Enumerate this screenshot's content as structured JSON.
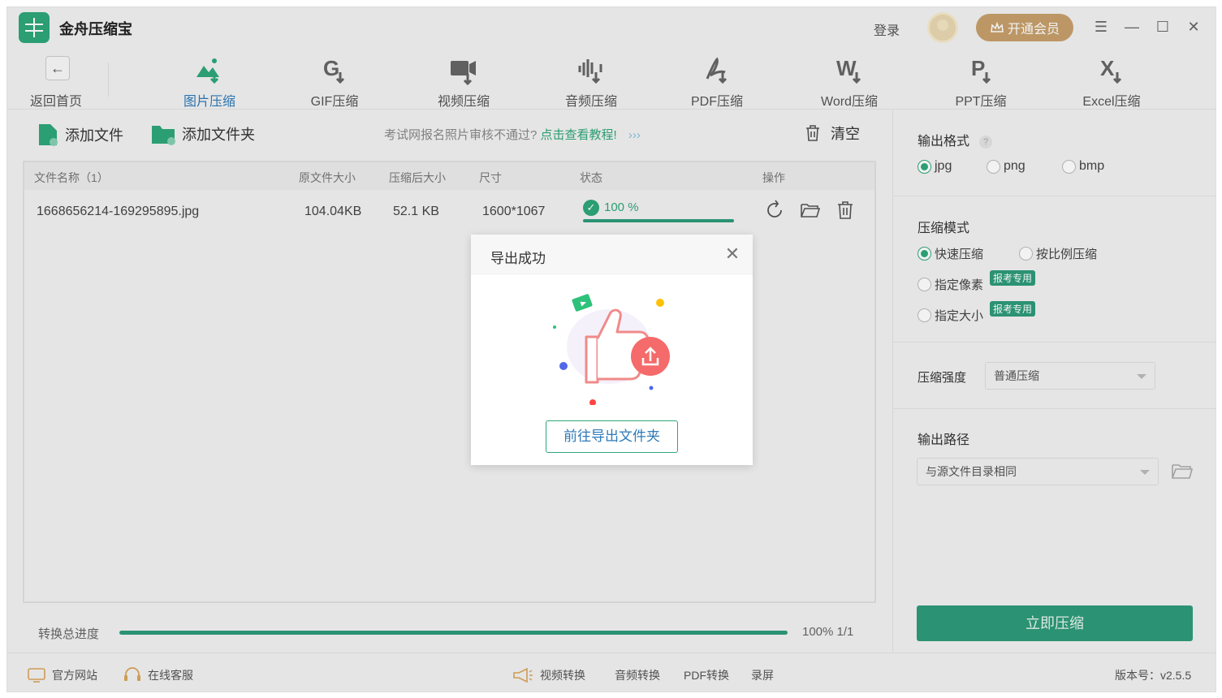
{
  "app": {
    "title": "金舟压缩宝"
  },
  "header": {
    "login": "登录",
    "vip": "开通会员"
  },
  "toolbar": {
    "back_label": "返回首页",
    "tools": [
      {
        "label": "图片压缩",
        "icon": "image-compress-icon",
        "active": true
      },
      {
        "label": "GIF压缩",
        "icon": "gif-compress-icon"
      },
      {
        "label": "视频压缩",
        "icon": "video-compress-icon"
      },
      {
        "label": "音频压缩",
        "icon": "audio-compress-icon"
      },
      {
        "label": "PDF压缩",
        "icon": "pdf-compress-icon"
      },
      {
        "label": "Word压缩",
        "icon": "word-compress-icon"
      },
      {
        "label": "PPT压缩",
        "icon": "ppt-compress-icon"
      },
      {
        "label": "Excel压缩",
        "icon": "excel-compress-icon"
      }
    ]
  },
  "actions": {
    "add_file": "添加文件",
    "add_folder": "添加文件夹",
    "tip_text": "考试网报名照片审核不通过?",
    "tip_link": "点击查看教程!",
    "tip_arrows": "›››",
    "clear": "清空"
  },
  "table": {
    "headers": {
      "name": "文件名称（1）",
      "orig_size": "原文件大小",
      "new_size": "压缩后大小",
      "dimension": "尺寸",
      "status": "状态",
      "ops": "操作"
    },
    "rows": [
      {
        "name": "1668656214-169295895.jpg",
        "orig_size": "104.04KB",
        "new_size": "52.1 KB",
        "dimension": "1600*1067",
        "status": "100 %",
        "progress": 1.0
      }
    ]
  },
  "progress": {
    "label": "转换总进度",
    "text": "100% 1/1",
    "value": 1.0
  },
  "settings": {
    "format_title": "输出格式",
    "help": "?",
    "formats": [
      "jpg",
      "png",
      "bmp"
    ],
    "format_selected": "jpg",
    "mode_title": "压缩模式",
    "modes": [
      "快速压缩",
      "按比例压缩",
      "指定像素",
      "指定大小"
    ],
    "mode_selected": "快速压缩",
    "mode_tag": "报考专用",
    "strength_title": "压缩强度",
    "strength_value": "普通压缩",
    "path_title": "输出路径",
    "path_value": "与源文件目录相同",
    "compress_button": "立即压缩"
  },
  "statusbar": {
    "website": "官方网站",
    "support": "在线客服",
    "video_convert": "视频转换",
    "audio_convert": "音频转换",
    "pdf_convert": "PDF转换",
    "record": "录屏",
    "version": "版本号：v2.5.5"
  },
  "dialog": {
    "title": "导出成功",
    "button": "前往导出文件夹"
  },
  "colors": {
    "accent": "#2ea77a",
    "primary_button": "#2e9a7a",
    "link_blue": "#2e7ab8",
    "vip": "#c7a06b"
  }
}
